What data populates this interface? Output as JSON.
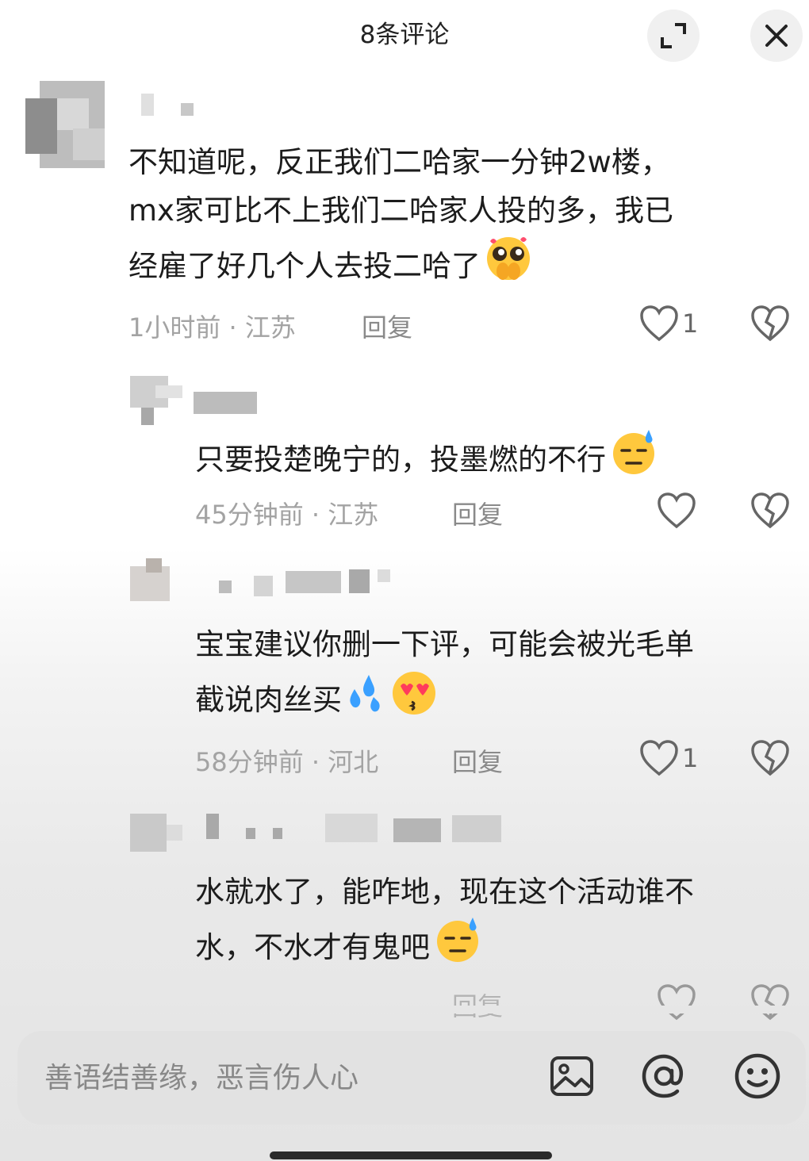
{
  "header": {
    "title": "8条评论"
  },
  "comments": [
    {
      "lines": [
        "不知道呢，反正我们二哈家一分钟2w楼，",
        "mx家可比不上我们二哈家人投的多，我已",
        "经雇了好几个人去投二哈了"
      ],
      "emoji": [
        "pleading-hands-emoji"
      ],
      "meta": "1小时前 · 江苏",
      "reply": "回复",
      "likes": "1"
    },
    {
      "lines": [
        "只要投楚晚宁的，投墨燃的不行"
      ],
      "emoji": [
        "sweat-smile-emoji"
      ],
      "meta": "45分钟前 · 江苏",
      "reply": "回复",
      "likes": ""
    },
    {
      "lines": [
        "宝宝建议你删一下评，可能会被光毛单",
        "截说肉丝买"
      ],
      "emoji": [
        "sweat-drops-emoji",
        "kissing-heart-eyes-emoji"
      ],
      "meta": "58分钟前 · 河北",
      "reply": "回复",
      "likes": "1"
    },
    {
      "lines": [
        "水就水了，能咋地，现在这个活动谁不",
        "水，不水才有鬼吧"
      ],
      "emoji": [
        "sweat-smile-emoji"
      ],
      "meta": "",
      "reply": "回复",
      "likes": ""
    }
  ],
  "input": {
    "placeholder": "善语结善缘，恶言伤人心"
  },
  "icons": [
    "expand-icon",
    "close-icon",
    "heart-icon",
    "broken-heart-icon",
    "image-icon",
    "at-icon",
    "emoji-icon"
  ],
  "colors": {
    "text": "#1c1c1c",
    "meta": "#a3a3a3",
    "bar": "#e2e2e2"
  }
}
